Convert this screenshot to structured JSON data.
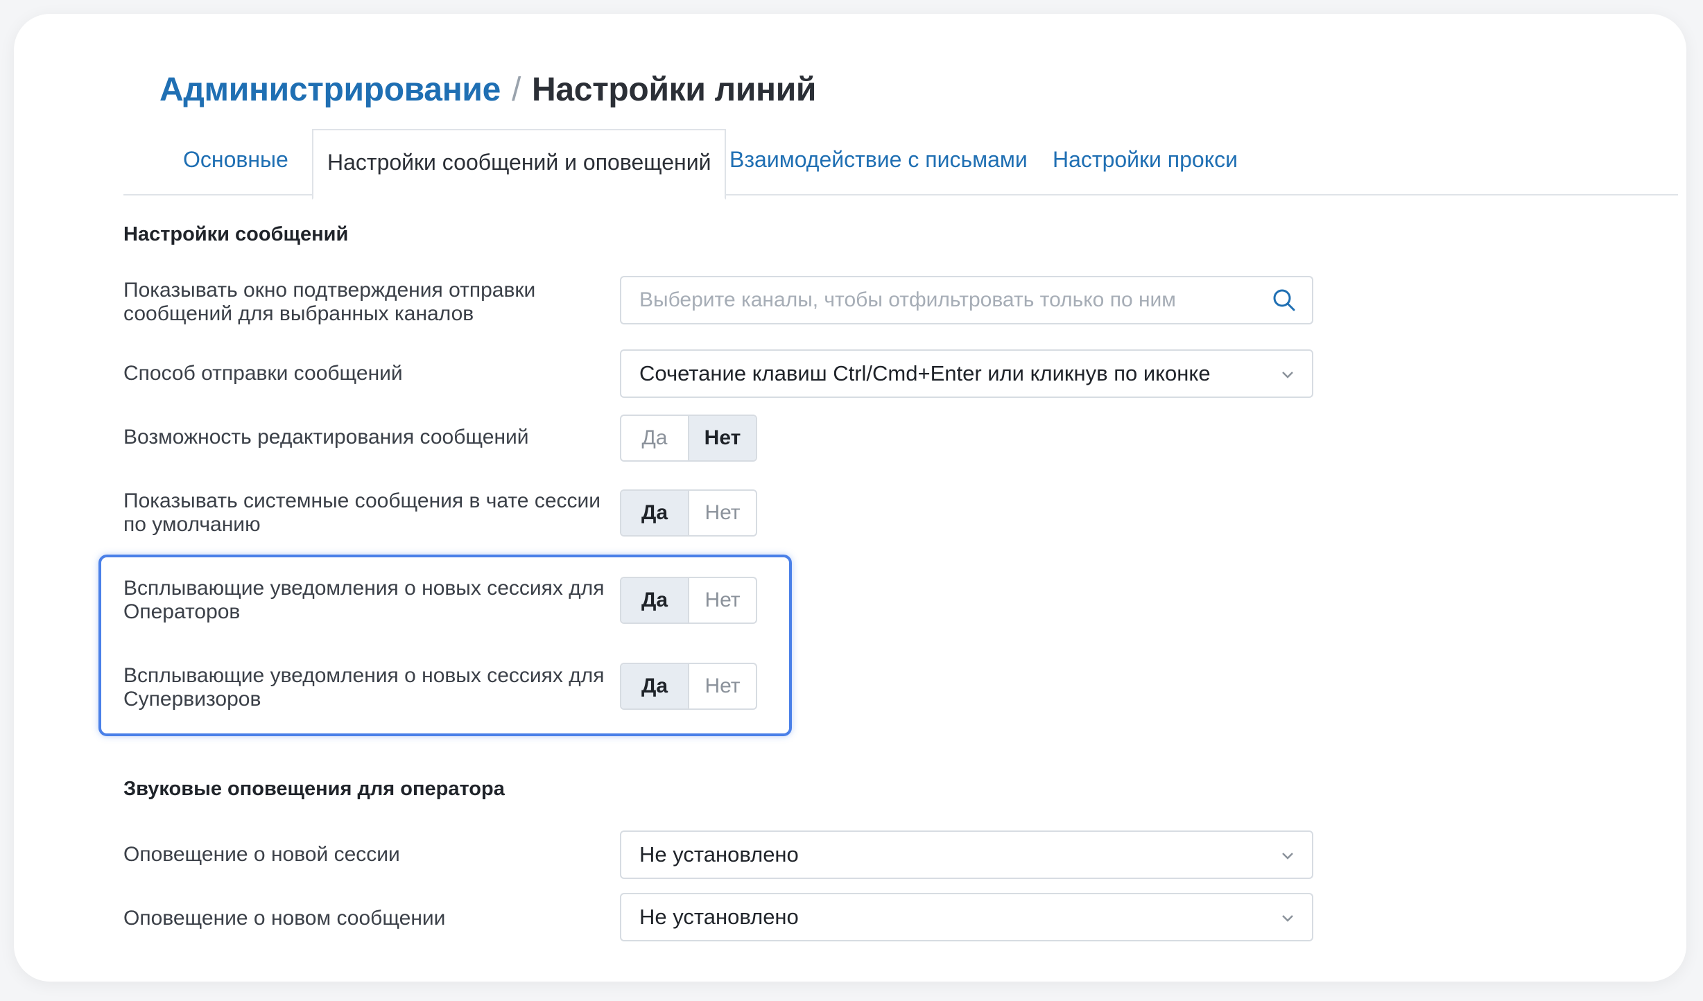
{
  "breadcrumb": {
    "parent": "Администрирование",
    "separator": "/",
    "current": "Настройки линий"
  },
  "tabs": [
    {
      "label": "Основные",
      "active": false
    },
    {
      "label": "Настройки сообщений и оповещений",
      "active": true
    },
    {
      "label": "Взаимодействие с письмами",
      "active": false
    },
    {
      "label": "Настройки прокси",
      "active": false
    }
  ],
  "messages_section": {
    "title": "Настройки сообщений",
    "confirm_window": {
      "label": "Показывать окно подтверждения отправки сообщений для выбранных каналов",
      "placeholder": "Выберите каналы, чтобы отфильтровать только по ним",
      "icon": "search-icon"
    },
    "send_method": {
      "label": "Способ отправки сообщений",
      "value": "Сочетание клавиш Ctrl/Cmd+Enter или кликнув по иконке"
    },
    "edit_messages": {
      "label": "Возможность редактирования сообщений",
      "yes": "Да",
      "no": "Нет",
      "selected": "no"
    },
    "system_messages": {
      "label": "Показывать системные сообщения в чате сессии по умолчанию",
      "yes": "Да",
      "no": "Нет",
      "selected": "yes"
    },
    "popup_operators": {
      "label": "Всплывающие уведомления о новых сессиях для Операторов",
      "yes": "Да",
      "no": "Нет",
      "selected": "yes"
    },
    "popup_supervisors": {
      "label": "Всплывающие уведомления о новых сессиях для Супервизоров",
      "yes": "Да",
      "no": "Нет",
      "selected": "yes"
    }
  },
  "sound_section": {
    "title": "Звуковые оповещения для оператора",
    "new_session": {
      "label": "Оповещение о новой сессии",
      "value": "Не установлено"
    },
    "new_message": {
      "label": "Оповещение о новом сообщении",
      "value": "Не установлено"
    }
  },
  "colors": {
    "link": "#1f6fb3",
    "highlight": "#4a80e8",
    "toggle_on_bg": "#e7ecf2"
  }
}
